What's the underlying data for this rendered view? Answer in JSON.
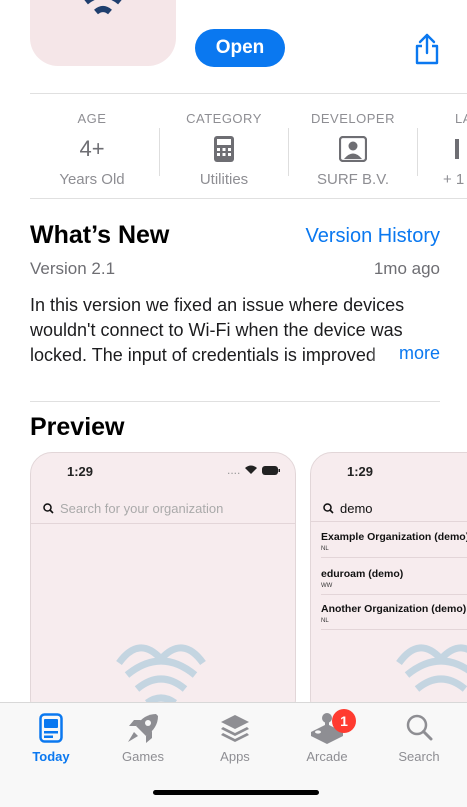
{
  "header": {
    "open_label": "Open"
  },
  "info": [
    {
      "label": "AGE",
      "value": "4+",
      "sub": "Years Old"
    },
    {
      "label": "CATEGORY",
      "value": "",
      "sub": "Utilities"
    },
    {
      "label": "DEVELOPER",
      "value": "",
      "sub": "SURF B.V."
    },
    {
      "label": "LAN",
      "value": "",
      "sub": "+ 1"
    }
  ],
  "whats_new": {
    "title": "What’s New",
    "history_link": "Version History",
    "version": "Version 2.1",
    "ago": "1mo ago",
    "notes": "In this version we fixed an issue where devices wouldn't connect to Wi-Fi when the device was locked. The input of credentials is improved",
    "more": "more"
  },
  "preview": {
    "title": "Preview",
    "card1": {
      "time": "1:29",
      "status": "....",
      "search_placeholder": "Search for your organization"
    },
    "card2": {
      "time": "1:29",
      "search_value": "demo",
      "results": [
        {
          "name": "Example Organization (demo)",
          "code": "NL"
        },
        {
          "name": "eduroam (demo)",
          "code": "WW"
        },
        {
          "name": "Another Organization (demo)",
          "code": "NL"
        }
      ]
    }
  },
  "tabbar": {
    "tabs": [
      {
        "label": "Today",
        "icon": "today-icon",
        "active": true
      },
      {
        "label": "Games",
        "icon": "rocket-icon"
      },
      {
        "label": "Apps",
        "icon": "layers-icon"
      },
      {
        "label": "Arcade",
        "icon": "joystick-icon",
        "badge": "1"
      },
      {
        "label": "Search",
        "icon": "search-icon"
      }
    ]
  },
  "colors": {
    "accent": "#0a78f0",
    "badge": "#ff3b30",
    "icon_bg": "#f5e6e8"
  }
}
